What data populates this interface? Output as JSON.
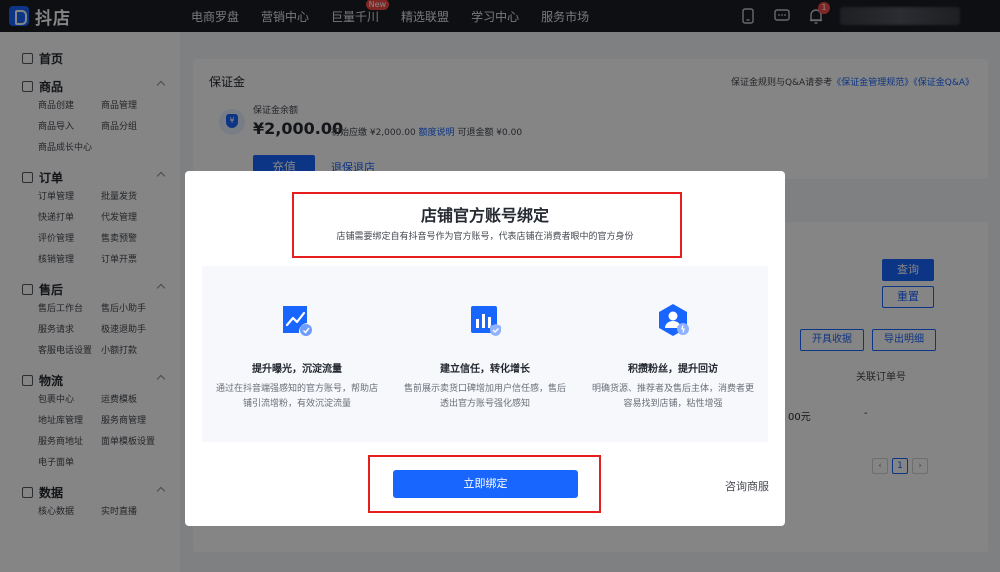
{
  "app": {
    "logo_text": "抖店"
  },
  "nav": [
    "电商罗盘",
    "营销中心",
    "巨量千川",
    "精选联盟",
    "学习中心",
    "服务市场"
  ],
  "nav_new_badge": "New",
  "top_icons": {
    "phone": "phone-icon",
    "message": "message-icon",
    "bell": "bell-icon",
    "bell_count": "1"
  },
  "sidebar": {
    "home": "首页",
    "groups": [
      {
        "title": "商品",
        "items": [
          "商品创建",
          "商品管理",
          "商品导入",
          "商品分组",
          "商品成长中心"
        ]
      },
      {
        "title": "订单",
        "items": [
          "订单管理",
          "批量发货",
          "快递打单",
          "代发管理",
          "评价管理",
          "售卖预警",
          "核销管理",
          "订单开票"
        ]
      },
      {
        "title": "售后",
        "items": [
          "售后工作台",
          "售后小助手",
          "服务请求",
          "极速退助手",
          "客服电话设置",
          "小额打款"
        ]
      },
      {
        "title": "物流",
        "items": [
          "包裹中心",
          "运费模板",
          "地址库管理",
          "服务商管理",
          "服务商地址",
          "面单模板设置",
          "电子面单"
        ]
      },
      {
        "title": "数据",
        "items": [
          "核心数据",
          "实时直播"
        ]
      }
    ]
  },
  "deposit": {
    "title": "保证金",
    "rules_prefix": "保证金规则与Q&A请参考",
    "rules_link1": "《保证金管理规范》",
    "rules_link2": "《保证金Q&A》",
    "balance_label": "保证金余额",
    "balance": "¥2,000.00",
    "initial": "初始应缴 ¥2,000.00",
    "quota_link": "额度说明",
    "refundable": "可退金额 ¥0.00",
    "recharge": "充值",
    "withdraw": "退保退店"
  },
  "records": {
    "query": "查询",
    "reset": "重置",
    "receipt": "开具收据",
    "export": "导出明细",
    "col_order": "关联订单号",
    "row_amount": "00元",
    "row_order": "-",
    "page_current": "1"
  },
  "modal": {
    "title": "店铺官方账号绑定",
    "subtitle": "店铺需要绑定自有抖音号作为官方账号，代表店铺在消费者眼中的官方身份",
    "features": [
      {
        "icon": "trend-up-icon",
        "title": "提升曝光，沉淀流量",
        "desc": "通过在抖音端强感知的官方账号，帮助店铺引流增粉，有效沉淀流量"
      },
      {
        "icon": "trust-chart-icon",
        "title": "建立信任，转化增长",
        "desc": "售前展示卖货口碑增加用户信任感，售后透出官方账号强化感知"
      },
      {
        "icon": "fans-group-icon",
        "title": "积攒粉丝，提升回访",
        "desc": "明确货源、推荐者及售后主体，消费者更容易找到店铺，粘性增强"
      }
    ],
    "bind_button": "立即绑定",
    "consult": "咨询商服"
  },
  "colors": {
    "primary": "#1966ff",
    "highlight": "#e61e1e",
    "topbar": "#1b1d24"
  }
}
